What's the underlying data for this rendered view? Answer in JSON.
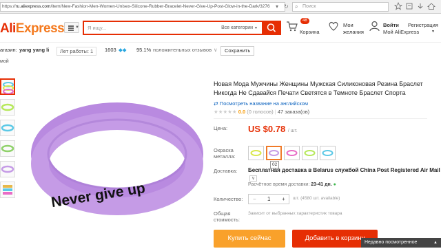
{
  "browser": {
    "url_scheme": "https://",
    "url_host": "ru.aliexpress.com",
    "url_path": "/item/New-Fashion-Men-Women-Unisex-Silicone-Rubber-Bracelet-Never-Give-Up-Post-Glow-in-the-Dark/3276",
    "search_placeholder": "Поиск"
  },
  "header": {
    "logo_ali": "Ali",
    "logo_express": "Express",
    "logo_reg": "®",
    "search_placeholder": "Я ищу...",
    "category_select": "Все категории",
    "cart_count": "48",
    "cart_label": "Корзина",
    "wishlist_line1": "Мои",
    "wishlist_line2": "желания",
    "login_label": "Войти",
    "register_label": "Регистрация",
    "my_ali_label": "Мой AliExpress"
  },
  "store": {
    "prefix": "агазин:",
    "name": "yang yang li",
    "years": "Лет работы: 1",
    "score": "1603",
    "feedback_pct": "95.1%",
    "feedback_text": "положительных отзывов",
    "save_label": "Сохранить"
  },
  "breadcrumb": "мой",
  "product": {
    "title": "Новая Мода Мужчины Женщины Мужская Силиконовая Резина Браслет Никогда Не Сдавайся Печати Светятся в Темноте Браслет Спорта",
    "translate_link": "Посмотреть название на английском",
    "rating_value": "0.0",
    "rating_votes": "(0 голосов)",
    "orders": "47 заказа(ов)",
    "image_text": "Never give up",
    "price_label": "Цена:",
    "price": "US $0.78",
    "price_unit": "/ шт.",
    "color_label_1": "Окраска",
    "color_label_2": "металла:",
    "swatch_tooltip": "02",
    "delivery_label": "Доставка:",
    "delivery_text": "Бесплатная доставка в Belarus службой China Post Registered Air Mail",
    "delivery_dropdown": "∨",
    "eta_label": "Расчётное время доставки:",
    "eta_value": "23-41 дн.",
    "qty_label": "Количество:",
    "qty_minus": "−",
    "qty_value": "1",
    "qty_plus": "+",
    "qty_available": "шт. (4580 шт. available)",
    "total_label_1": "Общая",
    "total_label_2": "стоимость:",
    "total_text": "Зависит от выбранных характеристик товара",
    "buy_now": "Купить сейчас",
    "add_to_cart": "Добавить в корзину"
  },
  "recently_viewed": "Недавно посмотренное",
  "colors": {
    "brand_red": "#e62e04",
    "brand_orange": "#f9a12b",
    "bracelet": "#c59be6",
    "swatch_colors": [
      "#d9e84a",
      "#c59be6",
      "#e86cc6",
      "#b6e85a",
      "#5cc9e6"
    ]
  }
}
